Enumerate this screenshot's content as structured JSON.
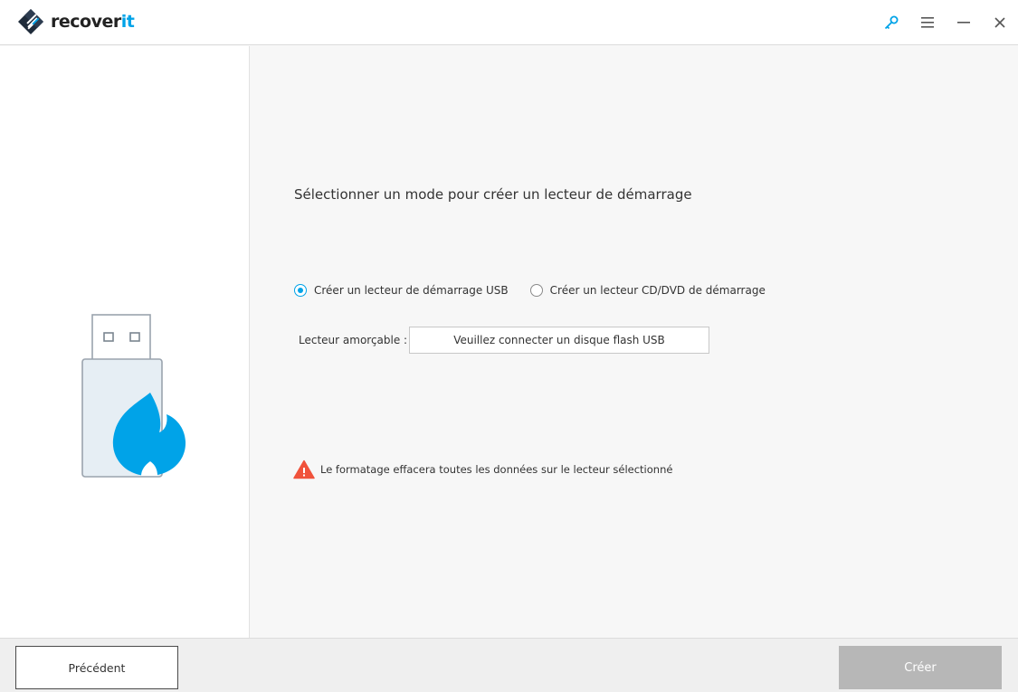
{
  "app": {
    "logo_text_main": "recover",
    "logo_text_accent": "it",
    "accent_color": "#00a3e8"
  },
  "window_controls": {
    "icons": [
      "key-icon",
      "menu-icon",
      "minimize-icon",
      "close-icon"
    ]
  },
  "main": {
    "title": "Sélectionner un mode pour créer un lecteur de démarrage",
    "options": [
      {
        "label": "Créer un lecteur de démarrage USB",
        "selected": true
      },
      {
        "label": "Créer un lecteur CD/DVD de démarrage",
        "selected": false
      }
    ],
    "drive_label": "Lecteur amorçable :",
    "drive_value": "Veuillez connecter un disque flash USB",
    "warning": "Le formatage effacera toutes les données sur le lecteur sélectionné",
    "warning_color": "#f0523b"
  },
  "footer": {
    "prev_label": "Précédent",
    "create_label": "Créer",
    "create_disabled": true
  }
}
